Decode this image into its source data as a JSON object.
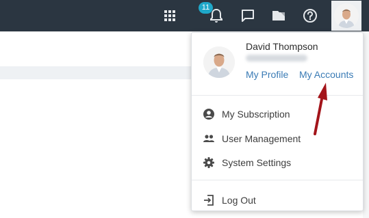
{
  "topbar": {
    "icons": {
      "apps": "apps-grid-icon",
      "notifications": "bell-icon",
      "messages": "chat-icon",
      "files": "folder-icon",
      "help": "help-icon",
      "account": "user-avatar"
    },
    "notification_count": "11",
    "colors": {
      "background": "#2b3641",
      "badge": "#1fa8c9"
    }
  },
  "user_menu": {
    "name": "David Thompson",
    "links": {
      "profile": "My Profile",
      "accounts": "My Accounts"
    },
    "items": [
      {
        "label": "My Subscription",
        "icon": "account-circle-icon"
      },
      {
        "label": "User Management",
        "icon": "people-icon"
      },
      {
        "label": "System Settings",
        "icon": "gear-icon"
      }
    ],
    "logout": {
      "label": "Log Out",
      "icon": "logout-icon"
    },
    "colors": {
      "link": "#3a7bb5",
      "annotation_arrow": "#a3141a"
    }
  }
}
